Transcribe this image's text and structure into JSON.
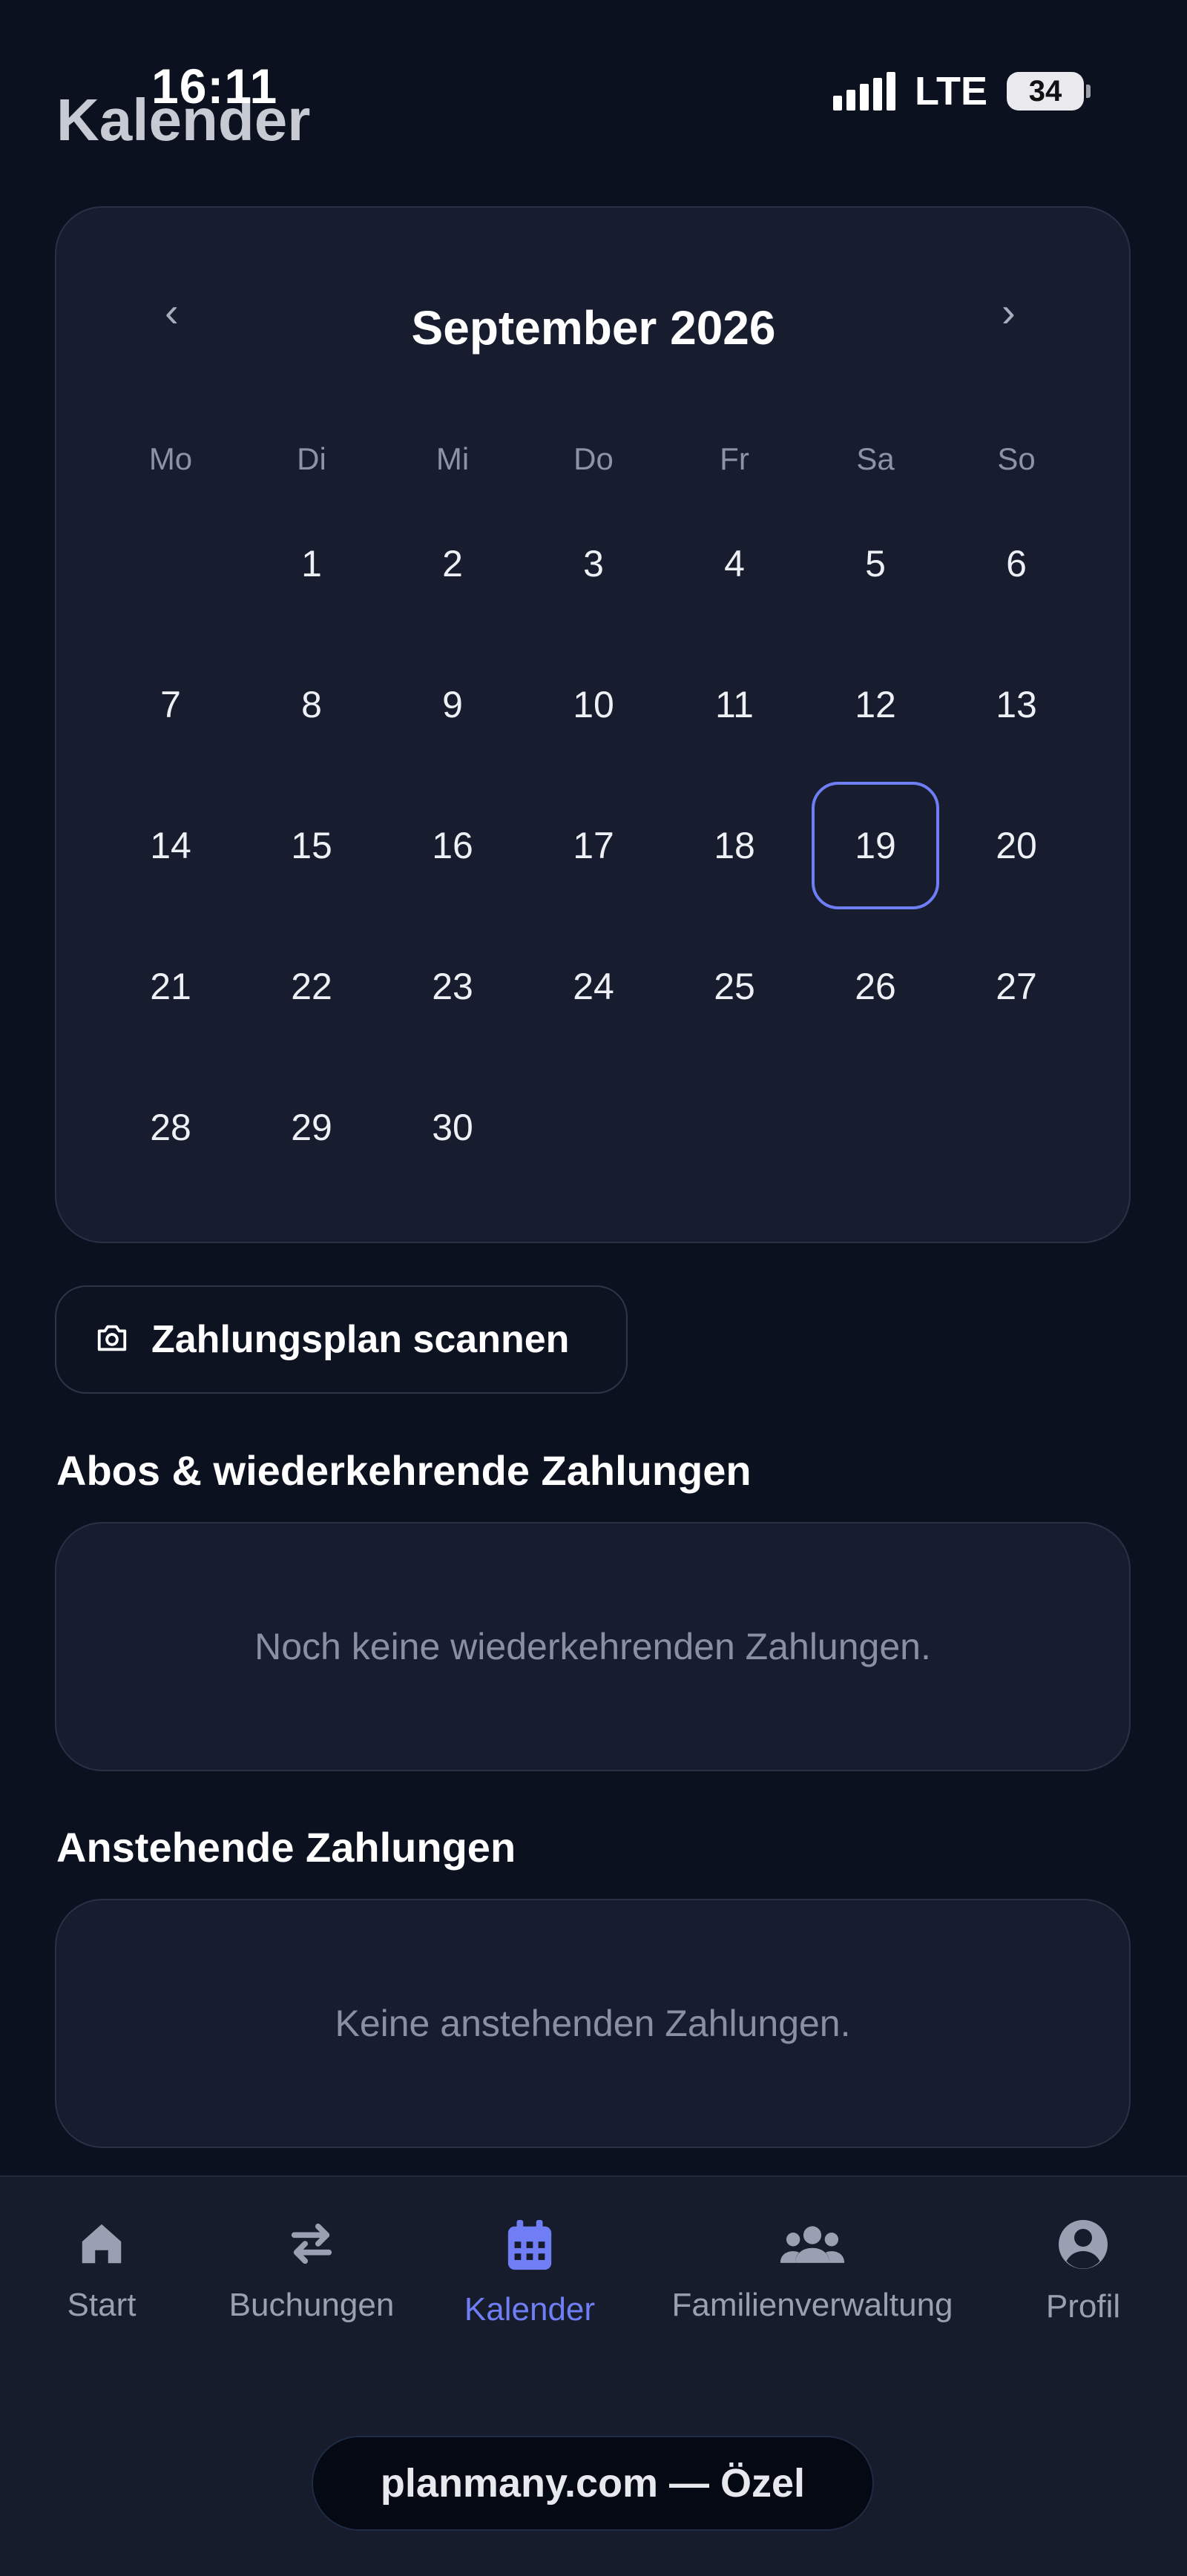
{
  "status_bar": {
    "time": "16:11",
    "network": "LTE",
    "battery": "34"
  },
  "header": {
    "title": "Kalender"
  },
  "calendar": {
    "month_label": "September 2026",
    "prev_label": "‹",
    "next_label": "›",
    "weekdays": [
      "Mo",
      "Di",
      "Mi",
      "Do",
      "Fr",
      "Sa",
      "So"
    ],
    "days": [
      "1",
      "2",
      "3",
      "4",
      "5",
      "6",
      "7",
      "8",
      "9",
      "10",
      "11",
      "12",
      "13",
      "14",
      "15",
      "16",
      "17",
      "18",
      "19",
      "20",
      "21",
      "22",
      "23",
      "24",
      "25",
      "26",
      "27",
      "28",
      "29",
      "30"
    ],
    "first_weekday_index": 1,
    "selected_day": "19"
  },
  "scan_button": {
    "label": "Zahlungsplan scannen",
    "icon": "camera-icon"
  },
  "subscriptions": {
    "title": "Abos & wiederkehrende Zahlungen",
    "empty_text": "Noch keine wiederkehrenden Zahlungen."
  },
  "upcoming": {
    "title": "Anstehende Zahlungen",
    "empty_text": "Keine anstehenden Zahlungen."
  },
  "nav": {
    "items": [
      {
        "label": "Start",
        "icon": "home-icon"
      },
      {
        "label": "Buchungen",
        "icon": "transfer-arrows-icon"
      },
      {
        "label": "Kalender",
        "icon": "calendar-icon",
        "active": true
      },
      {
        "label": "Familienverwaltung",
        "icon": "people-icon"
      },
      {
        "label": "Profil",
        "icon": "user-circle-icon"
      }
    ]
  },
  "footer": {
    "domain_text": "planmany.com — Özel"
  },
  "colors": {
    "background": "#0c1120",
    "card": "#171d2e",
    "accent": "#6f7ef5",
    "muted_text": "#8a90a4"
  }
}
